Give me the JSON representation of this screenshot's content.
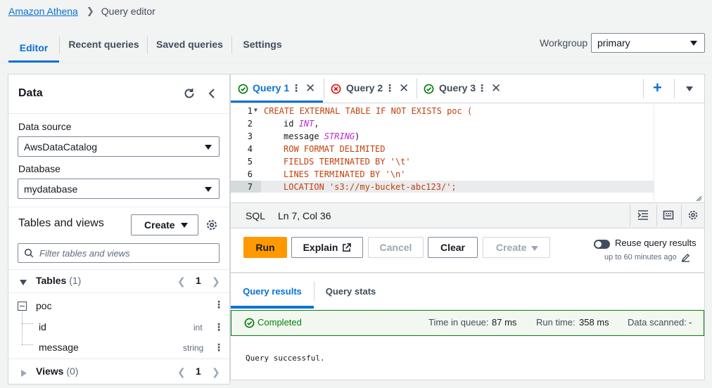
{
  "breadcrumb": {
    "root": "Amazon Athena",
    "current": "Query editor"
  },
  "nav_tabs": [
    {
      "label": "Editor",
      "active": true
    },
    {
      "label": "Recent queries"
    },
    {
      "label": "Saved queries"
    },
    {
      "label": "Settings"
    }
  ],
  "workgroup": {
    "label": "Workgroup",
    "value": "primary"
  },
  "data_panel": {
    "title": "Data",
    "data_source_label": "Data source",
    "data_source_value": "AwsDataCatalog",
    "database_label": "Database",
    "database_value": "mydatabase",
    "tables_views_title": "Tables and views",
    "create_label": "Create",
    "filter_placeholder": "Filter tables and views",
    "tables_label": "Tables",
    "tables_count": "(1)",
    "tables_page": "1",
    "table_name": "poc",
    "columns": [
      {
        "name": "id",
        "type": "int"
      },
      {
        "name": "message",
        "type": "string"
      }
    ],
    "views_label": "Views",
    "views_count": "(0)",
    "views_page": "1"
  },
  "query_tabs": [
    {
      "label": "Query 1",
      "status": "success",
      "active": true
    },
    {
      "label": "Query 2",
      "status": "error"
    },
    {
      "label": "Query 3",
      "status": "success"
    }
  ],
  "editor": {
    "line_numbers": [
      "1",
      "2",
      "3",
      "4",
      "5",
      "6",
      "7"
    ],
    "current_line": "7",
    "line1": "CREATE EXTERNAL TABLE IF NOT EXISTS poc (",
    "line2_a": "id ",
    "line2_b": "INT",
    "line2_c": ",",
    "line3_a": "message ",
    "line3_b": "STRING",
    "line3_c": ")",
    "line4": "ROW FORMAT DELIMITED",
    "line5": "FIELDS TERMINATED BY '\\t'",
    "line6": "LINES TERMINATED BY '\\n'",
    "line7": "LOCATION 's3://my-bucket-abc123/';",
    "lang": "SQL",
    "cursor": "Ln 7, Col 36"
  },
  "actions": {
    "run": "Run",
    "explain": "Explain",
    "cancel": "Cancel",
    "clear": "Clear",
    "create": "Create",
    "reuse_label": "Reuse query results",
    "reuse_sub": "up to 60 minutes ago"
  },
  "results_tabs": [
    {
      "label": "Query results",
      "active": true
    },
    {
      "label": "Query stats"
    }
  ],
  "status": {
    "completed": "Completed",
    "time_in_queue_label": "Time in queue:",
    "time_in_queue_value": "87 ms",
    "run_time_label": "Run time:",
    "run_time_value": "358 ms",
    "data_scanned_label": "Data scanned:",
    "data_scanned_value": "-"
  },
  "result_message": "Query successful.",
  "colors": {
    "link": "#0972d3",
    "accent": "#ff9900",
    "success": "#037f0c",
    "error": "#d91515"
  }
}
